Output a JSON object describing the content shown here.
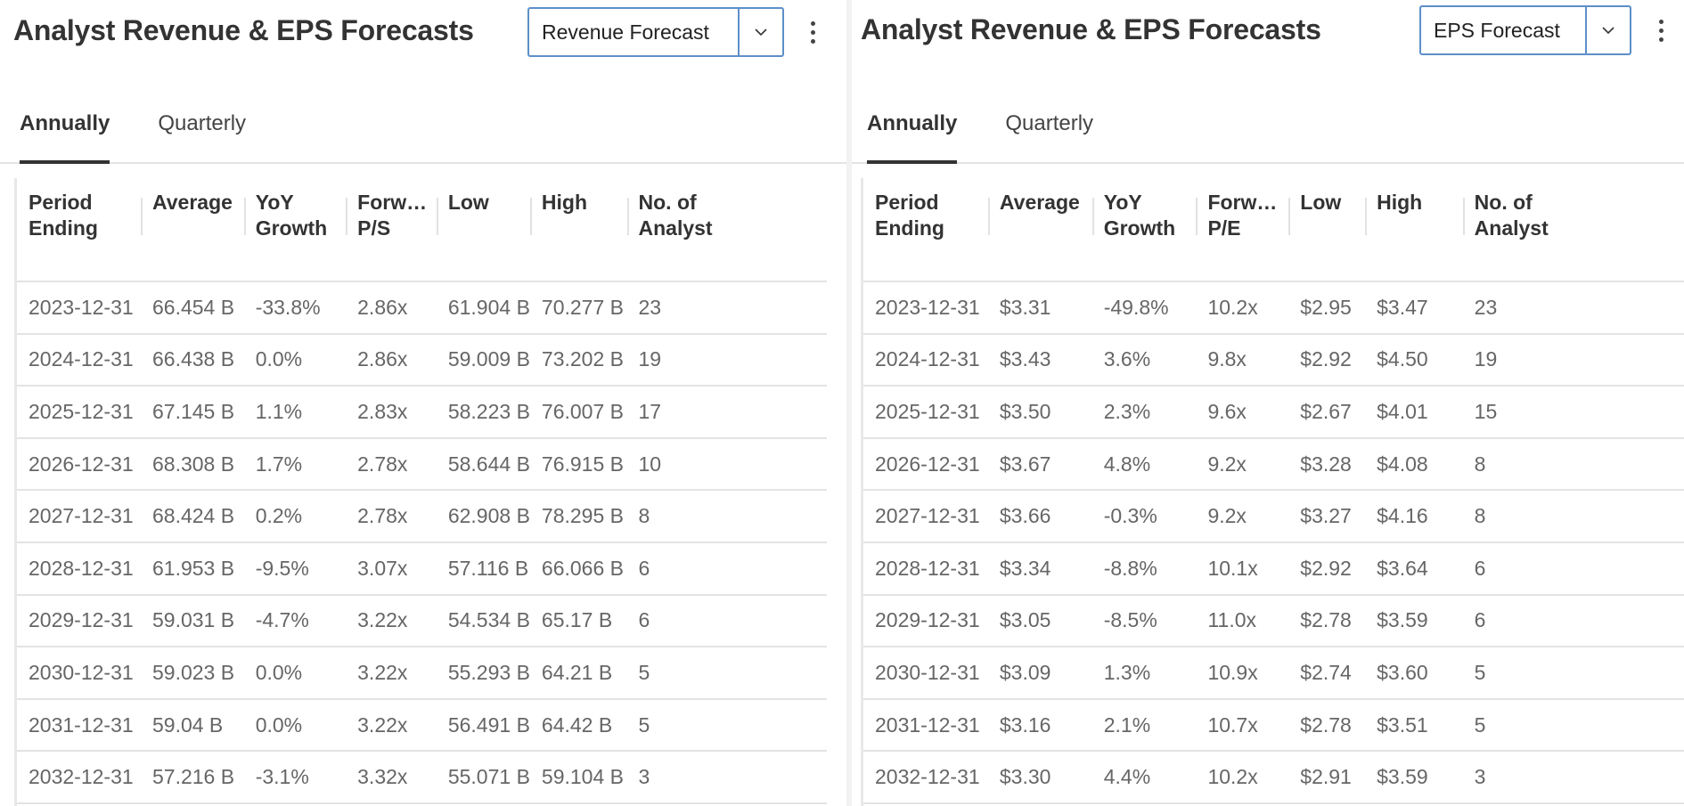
{
  "left": {
    "title": "Analyst Revenue & EPS Forecasts",
    "dropdown": {
      "selected": "Revenue Forecast"
    },
    "tabs": [
      {
        "label": "Annually",
        "active": true
      },
      {
        "label": "Quarterly",
        "active": false
      }
    ],
    "columns": [
      {
        "line1": "Period",
        "line2": "Ending"
      },
      {
        "line1": "Average",
        "line2": ""
      },
      {
        "line1": "YoY",
        "line2": "Growth"
      },
      {
        "line1": "Forw…",
        "line2": "P/S"
      },
      {
        "line1": "Low",
        "line2": ""
      },
      {
        "line1": "High",
        "line2": ""
      },
      {
        "line1": "No. of",
        "line2": "Analyst"
      }
    ],
    "rows": [
      [
        "2023-12-31",
        "66.454 B",
        "-33.8%",
        "2.86x",
        "61.904 B",
        "70.277 B",
        "23"
      ],
      [
        "2024-12-31",
        "66.438 B",
        "0.0%",
        "2.86x",
        "59.009 B",
        "73.202 B",
        "19"
      ],
      [
        "2025-12-31",
        "67.145 B",
        "1.1%",
        "2.83x",
        "58.223 B",
        "76.007 B",
        "17"
      ],
      [
        "2026-12-31",
        "68.308 B",
        "1.7%",
        "2.78x",
        "58.644 B",
        "76.915 B",
        "10"
      ],
      [
        "2027-12-31",
        "68.424 B",
        "0.2%",
        "2.78x",
        "62.908 B",
        "78.295 B",
        "8"
      ],
      [
        "2028-12-31",
        "61.953 B",
        "-9.5%",
        "3.07x",
        "57.116 B",
        "66.066 B",
        "6"
      ],
      [
        "2029-12-31",
        "59.031 B",
        "-4.7%",
        "3.22x",
        "54.534 B",
        "65.17 B",
        "6"
      ],
      [
        "2030-12-31",
        "59.023 B",
        "0.0%",
        "3.22x",
        "55.293 B",
        "64.21 B",
        "5"
      ],
      [
        "2031-12-31",
        "59.04 B",
        "0.0%",
        "3.22x",
        "56.491 B",
        "64.42 B",
        "5"
      ],
      [
        "2032-12-31",
        "57.216 B",
        "-3.1%",
        "3.32x",
        "55.071 B",
        "59.104 B",
        "3"
      ]
    ]
  },
  "right": {
    "title": "Analyst Revenue & EPS Forecasts",
    "dropdown": {
      "selected": "EPS Forecast"
    },
    "tabs": [
      {
        "label": "Annually",
        "active": true
      },
      {
        "label": "Quarterly",
        "active": false
      }
    ],
    "columns": [
      {
        "line1": "Period",
        "line2": "Ending"
      },
      {
        "line1": "Average",
        "line2": ""
      },
      {
        "line1": "YoY",
        "line2": "Growth"
      },
      {
        "line1": "Forw…",
        "line2": "P/E"
      },
      {
        "line1": "Low",
        "line2": ""
      },
      {
        "line1": "High",
        "line2": ""
      },
      {
        "line1": "No. of",
        "line2": "Analyst"
      }
    ],
    "rows": [
      [
        "2023-12-31",
        "$3.31",
        "-49.8%",
        "10.2x",
        "$2.95",
        "$3.47",
        "23"
      ],
      [
        "2024-12-31",
        "$3.43",
        "3.6%",
        "9.8x",
        "$2.92",
        "$4.50",
        "19"
      ],
      [
        "2025-12-31",
        "$3.50",
        "2.3%",
        "9.6x",
        "$2.67",
        "$4.01",
        "15"
      ],
      [
        "2026-12-31",
        "$3.67",
        "4.8%",
        "9.2x",
        "$3.28",
        "$4.08",
        "8"
      ],
      [
        "2027-12-31",
        "$3.66",
        "-0.3%",
        "9.2x",
        "$3.27",
        "$4.16",
        "8"
      ],
      [
        "2028-12-31",
        "$3.34",
        "-8.8%",
        "10.1x",
        "$2.92",
        "$3.64",
        "6"
      ],
      [
        "2029-12-31",
        "$3.05",
        "-8.5%",
        "11.0x",
        "$2.78",
        "$3.59",
        "6"
      ],
      [
        "2030-12-31",
        "$3.09",
        "1.3%",
        "10.9x",
        "$2.74",
        "$3.60",
        "5"
      ],
      [
        "2031-12-31",
        "$3.16",
        "2.1%",
        "10.7x",
        "$2.78",
        "$3.51",
        "5"
      ],
      [
        "2032-12-31",
        "$3.30",
        "4.4%",
        "10.2x",
        "$2.91",
        "$3.59",
        "3"
      ]
    ]
  },
  "colors": {
    "accent_border": "#5d8fc9",
    "text_dark": "#333333",
    "text_cell": "#666666",
    "divider": "#e3e3e3"
  }
}
